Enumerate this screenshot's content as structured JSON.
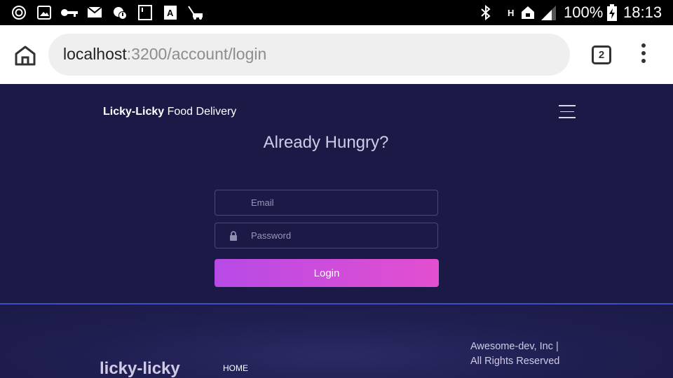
{
  "statusbar": {
    "battery": "100%",
    "time": "18:13",
    "network_label": "H",
    "icons": [
      "sync-icon",
      "image-icon",
      "key-icon",
      "mail-icon",
      "cloud-alert-icon",
      "sim-icon",
      "font-a-icon",
      "mower-icon",
      "bluetooth-icon",
      "home-network-icon",
      "signal-icon",
      "battery-charging-icon"
    ]
  },
  "browser": {
    "url_host": "localhost",
    "url_path": ":3200/account/login",
    "tab_count": "2"
  },
  "navbar": {
    "brand_bold": "Licky-Licky",
    "brand_rest": " Food Delivery"
  },
  "login": {
    "heading": "Already Hungry?",
    "email_placeholder": "Email",
    "password_placeholder": "Password",
    "submit_label": "Login"
  },
  "footer": {
    "brand": "licky-licky",
    "nav_home": "HOME",
    "copyright_line1": "Awesome-dev, Inc |",
    "copyright_line2": "All Rights Reserved"
  },
  "colors": {
    "page_bg": "#1b1a47",
    "accent_start": "#b74ae6",
    "accent_end": "#e34fcf",
    "divider": "#3d4fc2"
  }
}
